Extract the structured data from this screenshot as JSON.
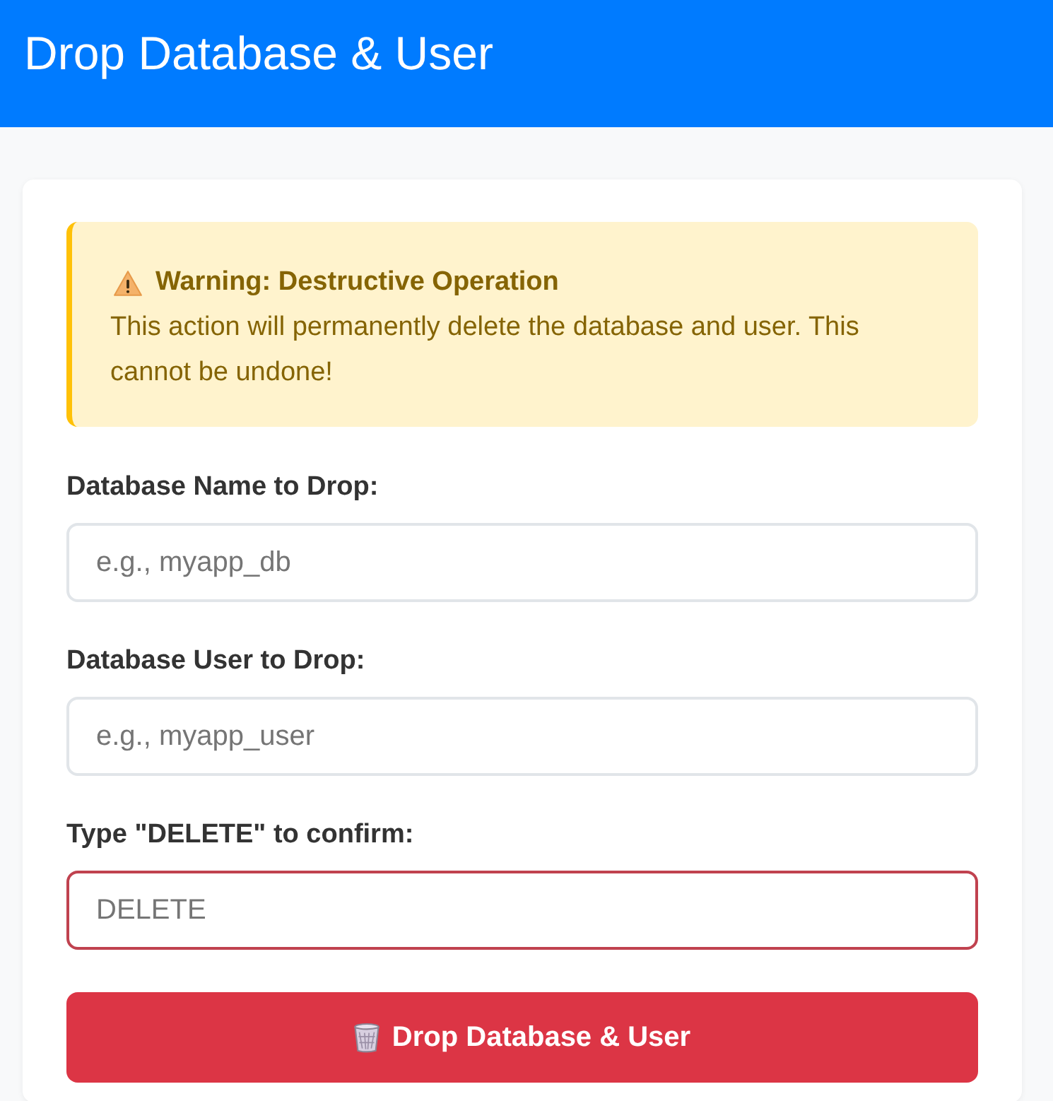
{
  "header": {
    "title": "Drop Database & User"
  },
  "warning": {
    "title": "Warning: Destructive Operation",
    "message": "This action will permanently delete the database and user. This cannot be undone!"
  },
  "fields": [
    {
      "label": "Database Name to Drop:",
      "placeholder": "e.g., myapp_db",
      "invalid": false
    },
    {
      "label": "Database User to Drop:",
      "placeholder": "e.g., myapp_user",
      "invalid": false
    },
    {
      "label": "Type \"DELETE\" to confirm:",
      "placeholder": "DELETE",
      "invalid": true
    }
  ],
  "submit_button": {
    "label": "Drop Database & User"
  }
}
